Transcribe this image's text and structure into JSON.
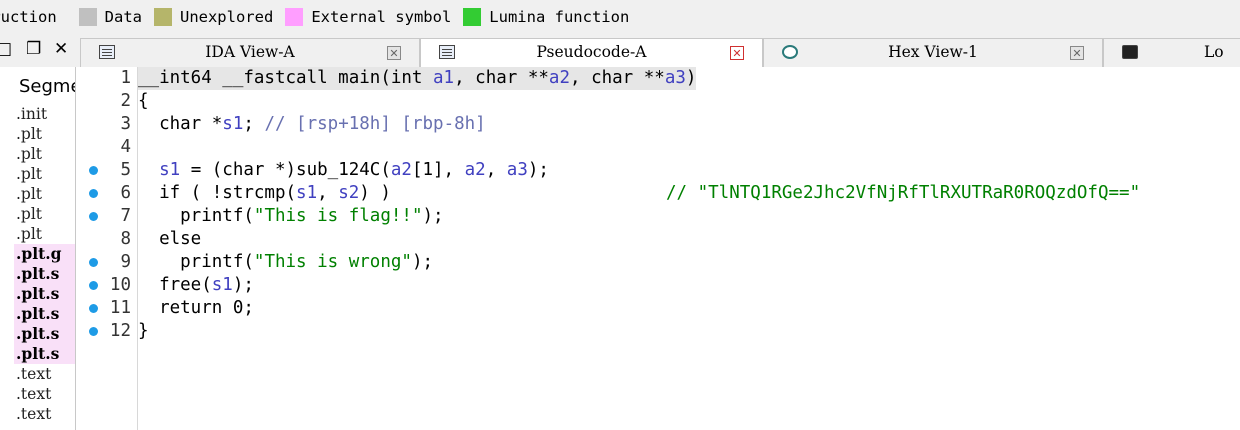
{
  "legend": [
    {
      "label": "truction",
      "color": null
    },
    {
      "label": "Data",
      "color": "#c0c0c0"
    },
    {
      "label": "Unexplored",
      "color": "#b5b56a"
    },
    {
      "label": "External symbol",
      "color": "#ff9eff"
    },
    {
      "label": "Lumina function",
      "color": "#33cc33"
    }
  ],
  "window_controls": {
    "restore": "❐",
    "close": "✕"
  },
  "tabs": [
    {
      "label": "IDA View-A",
      "active": false,
      "close": "✕"
    },
    {
      "label": "Pseudocode-A",
      "active": true,
      "close": "✕"
    },
    {
      "label": "Hex View-1",
      "active": false,
      "close": "✕"
    },
    {
      "label": "Lo",
      "active": false
    }
  ],
  "sidebar": {
    "header": "Segme",
    "segments": [
      {
        "name": ".init",
        "pink": false
      },
      {
        "name": ".plt",
        "pink": false
      },
      {
        "name": ".plt",
        "pink": false
      },
      {
        "name": ".plt",
        "pink": false
      },
      {
        "name": ".plt",
        "pink": false
      },
      {
        "name": ".plt",
        "pink": false
      },
      {
        "name": ".plt",
        "pink": false
      },
      {
        "name": ".plt.g",
        "pink": true
      },
      {
        "name": ".plt.s",
        "pink": true
      },
      {
        "name": ".plt.s",
        "pink": true
      },
      {
        "name": ".plt.s",
        "pink": true
      },
      {
        "name": ".plt.s",
        "pink": true
      },
      {
        "name": ".plt.s",
        "pink": true
      },
      {
        "name": ".text",
        "pink": false
      },
      {
        "name": ".text",
        "pink": false
      },
      {
        "name": ".text",
        "pink": false
      }
    ]
  },
  "code": {
    "lines": [
      {
        "num": "1",
        "dot": false,
        "text": "__int64 __fastcall main(int a1, char **a2, char **a3)",
        "comment": ""
      },
      {
        "num": "2",
        "dot": false,
        "text": "{",
        "comment": ""
      },
      {
        "num": "3",
        "dot": false,
        "text": "  char *s1; // [rsp+18h] [rbp-8h]",
        "comment": ""
      },
      {
        "num": "4",
        "dot": false,
        "text": "",
        "comment": ""
      },
      {
        "num": "5",
        "dot": true,
        "text": "  s1 = (char *)sub_124C(a2[1], a2, a3);",
        "comment": ""
      },
      {
        "num": "6",
        "dot": true,
        "text": "  if ( !strcmp(s1, s2) )",
        "comment": "// \"TlNTQ1RGe2Jhc2VfNjRfTlRXUTRaR0ROQzdOfQ==\""
      },
      {
        "num": "7",
        "dot": true,
        "text": "    printf(\"This is flag!!\");",
        "comment": ""
      },
      {
        "num": "8",
        "dot": false,
        "text": "  else",
        "comment": ""
      },
      {
        "num": "9",
        "dot": true,
        "text": "    printf(\"This is wrong\");",
        "comment": ""
      },
      {
        "num": "10",
        "dot": true,
        "text": "  free(s1);",
        "comment": ""
      },
      {
        "num": "11",
        "dot": true,
        "text": "  return 0;",
        "comment": ""
      },
      {
        "num": "12",
        "dot": true,
        "text": "}",
        "comment": ""
      }
    ]
  }
}
